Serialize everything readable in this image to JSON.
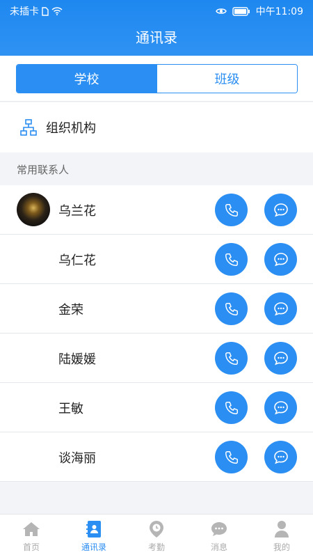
{
  "status_bar": {
    "carrier": "未插卡",
    "time": "中午11:09"
  },
  "header": {
    "title": "通讯录"
  },
  "segments": {
    "school": "学校",
    "class": "班级"
  },
  "org": {
    "label": "组织机构"
  },
  "section": {
    "title": "常用联系人"
  },
  "contacts": [
    {
      "name": "乌兰花"
    },
    {
      "name": "乌仁花"
    },
    {
      "name": "金荣"
    },
    {
      "name": "陆媛媛"
    },
    {
      "name": "王敏"
    },
    {
      "name": "谈海丽"
    }
  ],
  "tabs": [
    {
      "label": "首页",
      "icon": "home-icon"
    },
    {
      "label": "通讯录",
      "icon": "contacts-icon"
    },
    {
      "label": "考勤",
      "icon": "attendance-icon"
    },
    {
      "label": "消息",
      "icon": "message-icon"
    },
    {
      "label": "我的",
      "icon": "profile-icon"
    }
  ],
  "colors": {
    "primary": "#2b8ef2",
    "inactive": "#aaaaaa"
  }
}
